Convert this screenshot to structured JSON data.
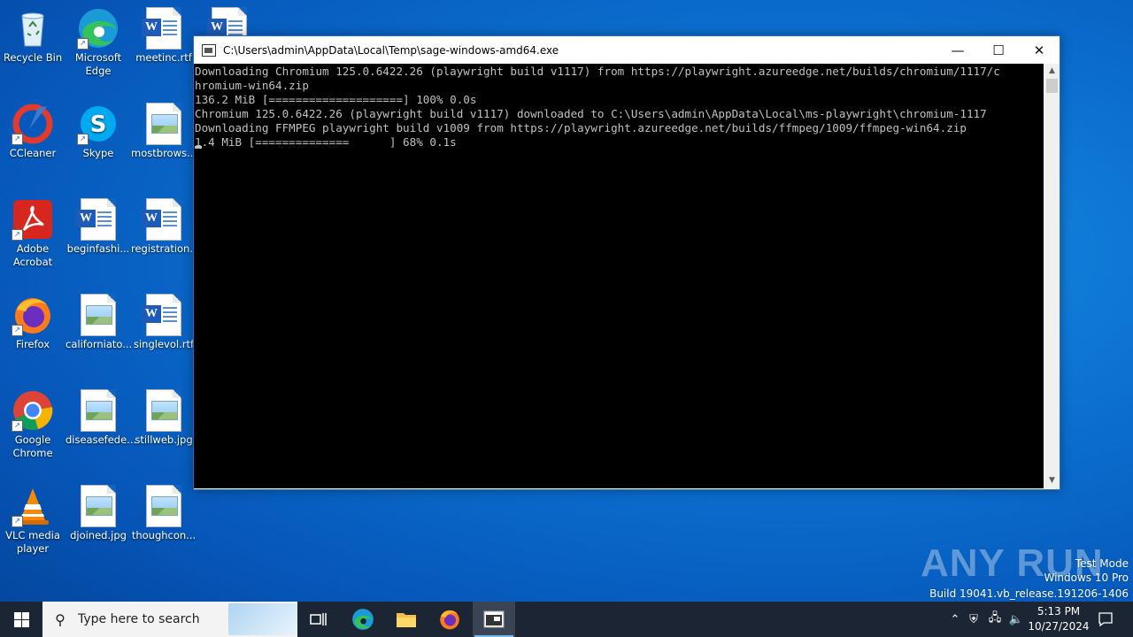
{
  "desktop": {
    "icons": [
      {
        "label": "Recycle Bin"
      },
      {
        "label": "Microsoft Edge"
      },
      {
        "label": "meetinc.rtf"
      },
      {
        "label": "CCleaner"
      },
      {
        "label": "Skype"
      },
      {
        "label": "mostbrows..."
      },
      {
        "label": "Adobe Acrobat"
      },
      {
        "label": "beginfashi..."
      },
      {
        "label": "registration..."
      },
      {
        "label": "Firefox"
      },
      {
        "label": "californiato..."
      },
      {
        "label": "singlevol.rtf"
      },
      {
        "label": "Google Chrome"
      },
      {
        "label": "diseasefede..."
      },
      {
        "label": "stillweb.jpg"
      },
      {
        "label": "VLC media player"
      },
      {
        "label": "djoined.jpg"
      },
      {
        "label": "thoughcon..."
      }
    ]
  },
  "window": {
    "title": "C:\\Users\\admin\\AppData\\Local\\Temp\\sage-windows-amd64.exe",
    "minimize": "—",
    "maximize": "☐",
    "close": "✕",
    "console_lines": [
      "Downloading Chromium 125.0.6422.26 (playwright build v1117) from https://playwright.azureedge.net/builds/chromium/1117/c",
      "hromium-win64.zip",
      "136.2 MiB [====================] 100% 0.0s",
      "Chromium 125.0.6422.26 (playwright build v1117) downloaded to C:\\Users\\admin\\AppData\\Local\\ms-playwright\\chromium-1117",
      "Downloading FFMPEG playwright build v1009 from https://playwright.azureedge.net/builds/ffmpeg/1009/ffmpeg-win64.zip"
    ],
    "progress_line": "1.4 MiB [==============      ] 68% 0.1s"
  },
  "watermark": {
    "brand": "ANY RUN",
    "mode": "Test Mode",
    "os": "Windows 10 Pro",
    "build": "Build 19041.vb_release.191206-1406"
  },
  "taskbar": {
    "search_placeholder": "Type here to search",
    "time": "5:13 PM",
    "date": "10/27/2024"
  },
  "colors": {
    "desktop_blue": "#0b6fd0",
    "taskbar": "#1c2533",
    "console_bg": "#000000",
    "console_text": "#c0c0c0"
  }
}
